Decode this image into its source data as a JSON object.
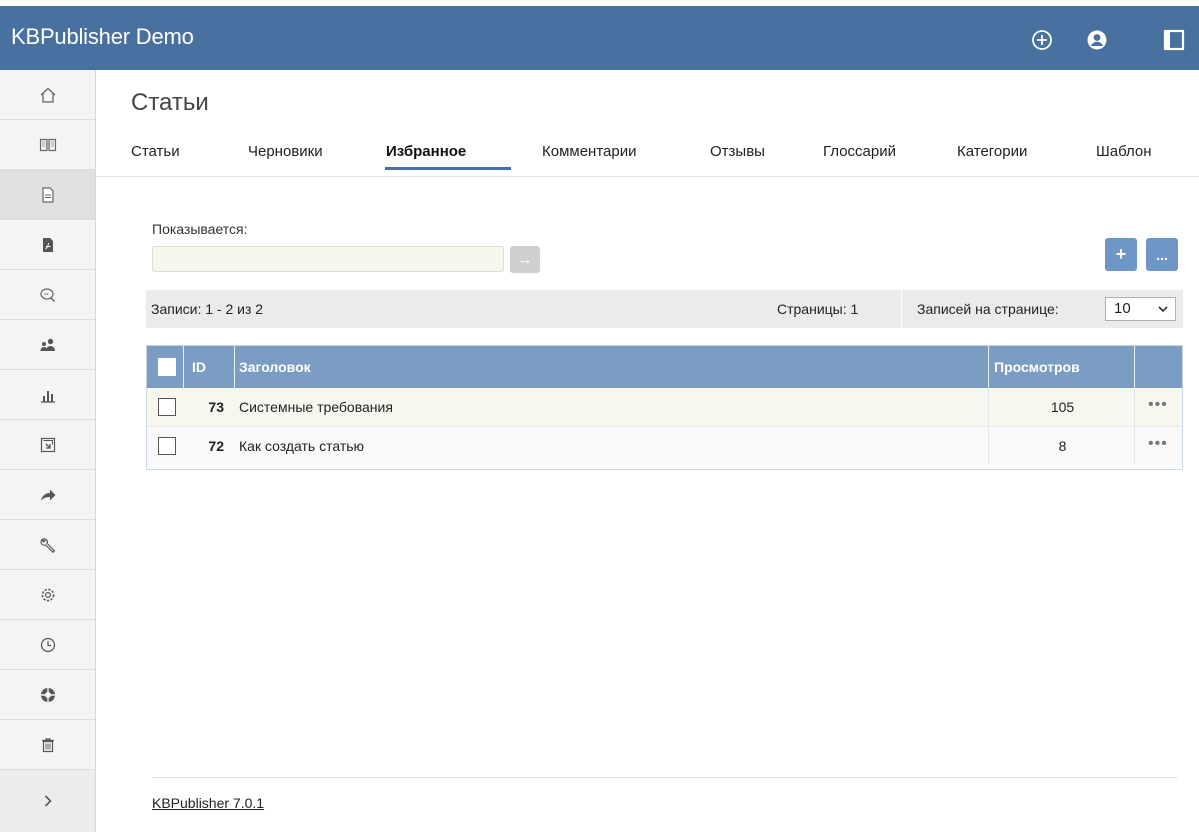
{
  "app": {
    "title": "KBPublisher Demo"
  },
  "topbar_icons": [
    "add-circle-icon",
    "user-circle-icon",
    "window-icon"
  ],
  "sidebar": {
    "items": [
      {
        "icon": "home-icon",
        "active": false
      },
      {
        "icon": "book-icon",
        "active": false
      },
      {
        "icon": "document-icon",
        "active": true
      },
      {
        "icon": "pdf-file-icon",
        "active": false
      },
      {
        "icon": "chat-search-icon",
        "active": false
      },
      {
        "icon": "users-icon",
        "active": false
      },
      {
        "icon": "bar-chart-icon",
        "active": false
      },
      {
        "icon": "import-icon",
        "active": false
      },
      {
        "icon": "share-arrow-icon",
        "active": false
      },
      {
        "icon": "wrench-icon",
        "active": false
      },
      {
        "icon": "gear-icon",
        "active": false
      },
      {
        "icon": "clock-icon",
        "active": false
      },
      {
        "icon": "lifebuoy-icon",
        "active": false
      },
      {
        "icon": "trash-icon",
        "active": false
      }
    ],
    "expand_icon": "chevron-right-icon"
  },
  "page": {
    "title": "Статьи"
  },
  "tabs": [
    {
      "label": "Статьи",
      "active": false
    },
    {
      "label": "Черновики",
      "active": false
    },
    {
      "label": "Избранное",
      "active": true
    },
    {
      "label": "Комментарии",
      "active": false
    },
    {
      "label": "Отзывы",
      "active": false
    },
    {
      "label": "Глоссарий",
      "active": false
    },
    {
      "label": "Категории",
      "active": false
    },
    {
      "label": "Шаблон",
      "active": false
    }
  ],
  "filter": {
    "label": "Показывается:",
    "value": "",
    "go_symbol": "→"
  },
  "actions": {
    "add_label": "+",
    "more_label": "..."
  },
  "paging": {
    "records": "Записи: 1 - 2 из 2",
    "pages": "Страницы: 1",
    "per_page_label": "Записей на странице:",
    "per_page_value": "10"
  },
  "table": {
    "headers": {
      "id": "ID",
      "title": "Заголовок",
      "views": "Просмотров"
    },
    "rows": [
      {
        "id": "73",
        "title": "Системные требования",
        "views": "105"
      },
      {
        "id": "72",
        "title": "Как создать статью",
        "views": "8"
      }
    ],
    "row_menu_symbol": "•••"
  },
  "footer": {
    "version_link": "KBPublisher 7.0.1"
  },
  "colors": {
    "topbar": "#48719f",
    "table_header": "#7b9dc4",
    "action_button": "#6e97c7"
  }
}
